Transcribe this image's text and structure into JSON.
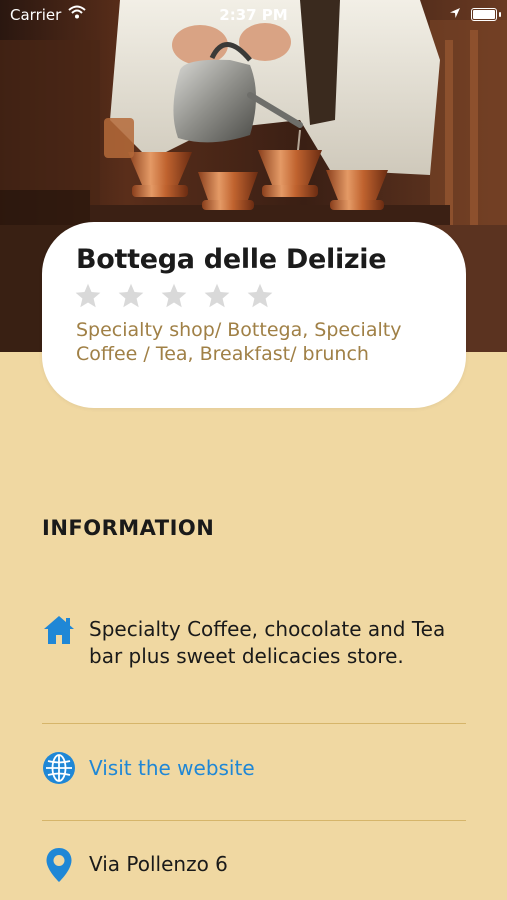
{
  "status_bar": {
    "carrier": "Carrier",
    "time": "2:37 PM"
  },
  "place": {
    "name": "Bottega delle Delizie",
    "rating": 0,
    "rating_max": 5,
    "categories": "Specialty shop/ Bottega, Specialty Coffee / Tea, Breakfast/ brunch"
  },
  "information": {
    "title": "INFORMATION",
    "description": "Specialty Coffee, chocolate and Tea bar plus sweet delicacies store.",
    "website_label": "Visit the website",
    "address": "Via Pollenzo 6"
  },
  "colors": {
    "background": "#f0d8a2",
    "accent_blue": "#1f87d6",
    "category_text": "#a08046",
    "star_empty": "#d9d9d9",
    "divider": "#d6b56a"
  },
  "icons": {
    "description": "home-icon",
    "website": "globe-icon",
    "address": "location-pin-icon"
  }
}
